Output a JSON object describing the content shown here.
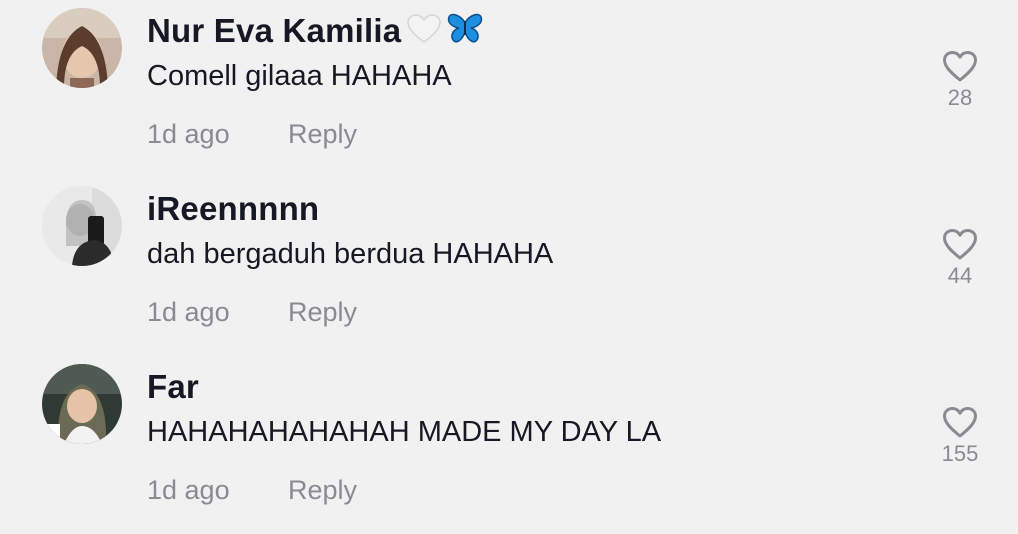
{
  "comments": [
    {
      "username": "Nur Eva Kamilia",
      "username_emojis": [
        "white-heart-icon",
        "butterfly-icon"
      ],
      "text": "Comell gilaaa HAHAHA",
      "time": "1d ago",
      "reply_label": "Reply",
      "likes": "28"
    },
    {
      "username": "iReennnnn",
      "text": "dah bergaduh berdua HAHAHA",
      "time": "1d ago",
      "reply_label": "Reply",
      "likes": "44"
    },
    {
      "username": "Far",
      "text": "HAHAHAHAHAHAH MADE MY DAY LA",
      "time": "1d ago",
      "reply_label": "Reply",
      "likes": "155"
    }
  ],
  "colors": {
    "background": "#f1f1f2",
    "text_primary": "#161823",
    "text_secondary": "#8a8b91",
    "butterfly": "#1d8fe0"
  }
}
